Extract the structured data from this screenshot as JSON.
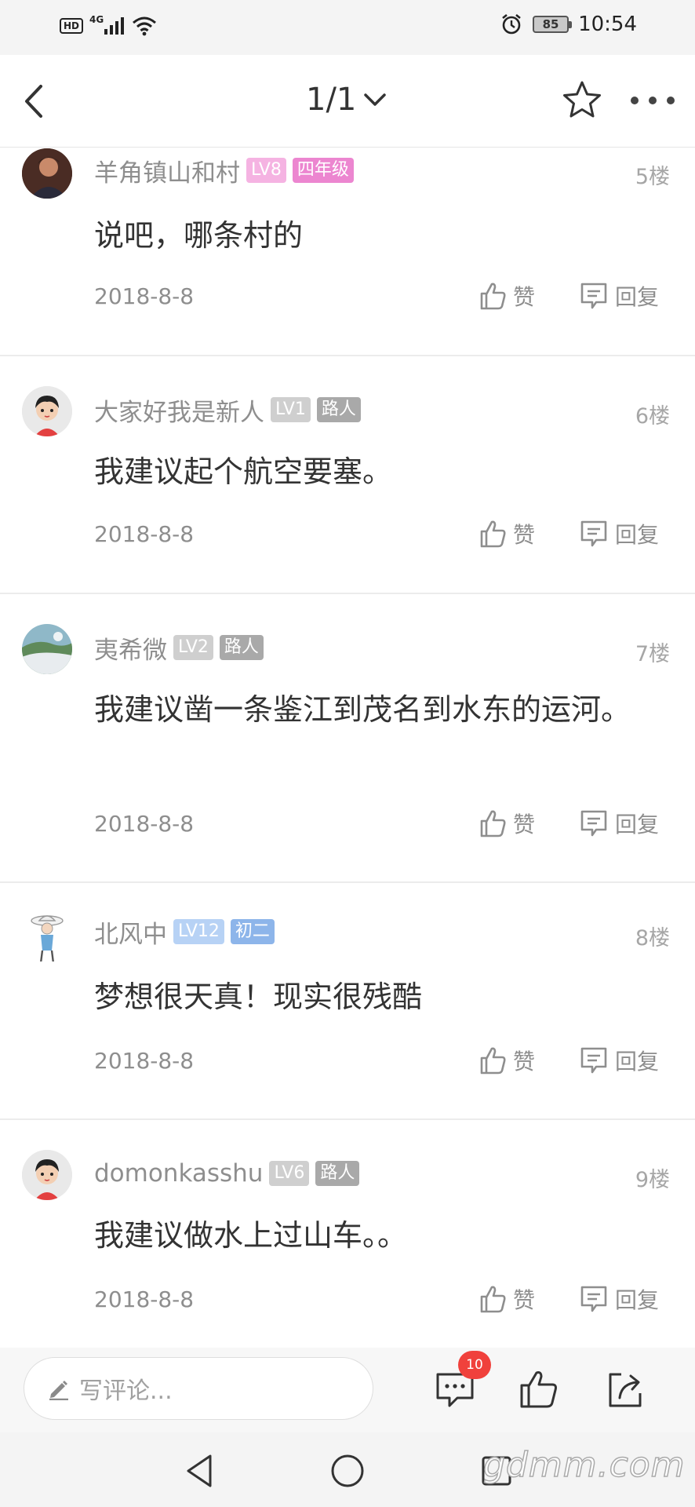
{
  "status_bar": {
    "hd": "HD",
    "network": "4G",
    "battery": "85",
    "time": "10:54"
  },
  "header": {
    "page_indicator": "1/1"
  },
  "actions": {
    "like_label": "赞",
    "reply_label": "回复"
  },
  "comments": [
    {
      "username": "羊角镇山和村",
      "level": "LV8",
      "grade": "四年级",
      "floor": "5楼",
      "text": "说吧，哪条村的",
      "date": "2018-8-8",
      "level_color": "#f5b3e2",
      "grade_color": "#ec86d0"
    },
    {
      "username": "大家好我是新人",
      "level": "LV1",
      "grade": "路人",
      "floor": "6楼",
      "text": "我建议起个航空要塞。",
      "date": "2018-8-8",
      "level_color": "#cfcfcf",
      "grade_color": "#a9a9a9"
    },
    {
      "username": "夷希微",
      "level": "LV2",
      "grade": "路人",
      "floor": "7楼",
      "text": "我建议凿一条鉴江到茂名到水东的运河。",
      "date": "2018-8-8",
      "level_color": "#cfcfcf",
      "grade_color": "#a9a9a9"
    },
    {
      "username": "北风中",
      "level": "LV12",
      "grade": "初二",
      "floor": "8楼",
      "text": "梦想很天真！现实很残酷",
      "date": "2018-8-8",
      "level_color": "#b7d2f5",
      "grade_color": "#8db5ea"
    },
    {
      "username": "domonkasshu",
      "level": "LV6",
      "grade": "路人",
      "floor": "9楼",
      "text": "我建议做水上过山车。。",
      "date": "2018-8-8",
      "level_color": "#cfcfcf",
      "grade_color": "#a9a9a9"
    }
  ],
  "bottom_bar": {
    "comment_placeholder": "写评论...",
    "comment_count": "10"
  },
  "watermark": "gdmm.com"
}
